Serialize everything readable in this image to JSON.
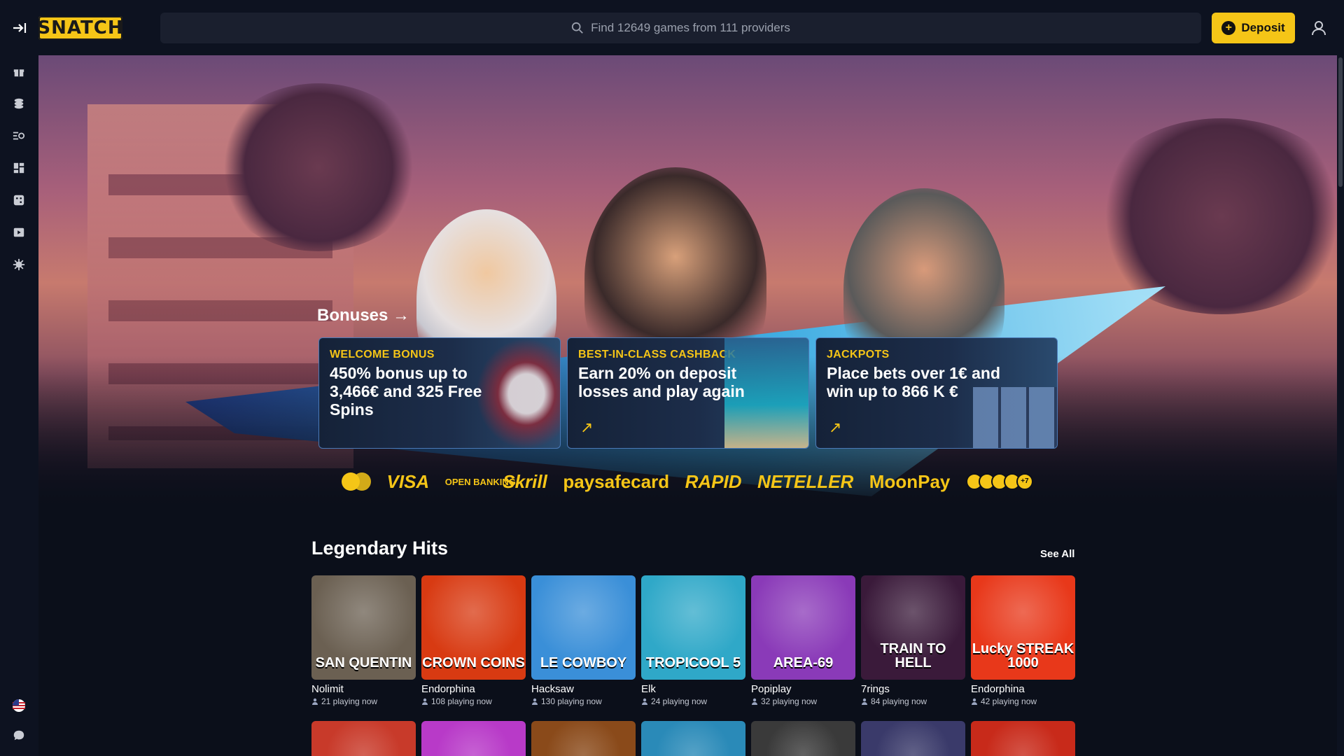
{
  "header": {
    "logo_text": "SNATCH",
    "search_placeholder": "Find 12649 games from 111 providers",
    "deposit_label": "Deposit"
  },
  "sidebar": {
    "icons": [
      "gift-icon",
      "coins-icon",
      "search-list-icon",
      "dashboard-icon",
      "dice-icon",
      "live-play-icon",
      "virus-icon"
    ],
    "bottom_icons": [
      "us-flag-icon",
      "chat-icon"
    ]
  },
  "hero": {
    "bonuses_title": "Bonuses →",
    "promos": [
      {
        "tag": "WELCOME BONUS",
        "text": "450% bonus up to 3,466€ and 325 Free Spins"
      },
      {
        "tag": "BEST-IN-CLASS CASHBACK",
        "text": "Earn 20% on deposit losses and play again"
      },
      {
        "tag": "JACKPOTS",
        "text": "Place bets over 1€ and win up to 866 K €"
      }
    ],
    "payments": {
      "visa": "VISA",
      "open_banking": "OPEN BANKING",
      "skrill": "Skrill",
      "paysafecard": "paysafecard",
      "rapid": "RAPID",
      "neteller": "NETELLER",
      "moonpay": "MoonPay",
      "more": "+7"
    }
  },
  "legendary": {
    "title": "Legendary Hits",
    "see_all": "See All",
    "games": [
      {
        "art": "SAN QUENTIN",
        "provider": "Nolimit",
        "playing": "21 playing now",
        "color": "#6b6052"
      },
      {
        "art": "CROWN COINS",
        "provider": "Endorphina",
        "playing": "108 playing now",
        "color": "#d83a12"
      },
      {
        "art": "LE COWBOY",
        "provider": "Hacksaw",
        "playing": "130 playing now",
        "color": "#3a8fd8"
      },
      {
        "art": "TROPICOOL 5",
        "provider": "Elk",
        "playing": "24 playing now",
        "color": "#2fa8c8"
      },
      {
        "art": "AREA-69",
        "provider": "Popiplay",
        "playing": "32 playing now",
        "color": "#8a3ab8"
      },
      {
        "art": "TRAIN TO HELL",
        "provider": "7rings",
        "playing": "84 playing now",
        "color": "#3a1a3a"
      },
      {
        "art": "Lucky STREAK 1000",
        "provider": "Endorphina",
        "playing": "42 playing now",
        "color": "#e8381a"
      }
    ],
    "next_row_colors": [
      "#c83a2a",
      "#b83ac8",
      "#8a4a1a",
      "#2a8ab8",
      "#3a3a3a",
      "#3a3a6a",
      "#c82a1a"
    ]
  }
}
